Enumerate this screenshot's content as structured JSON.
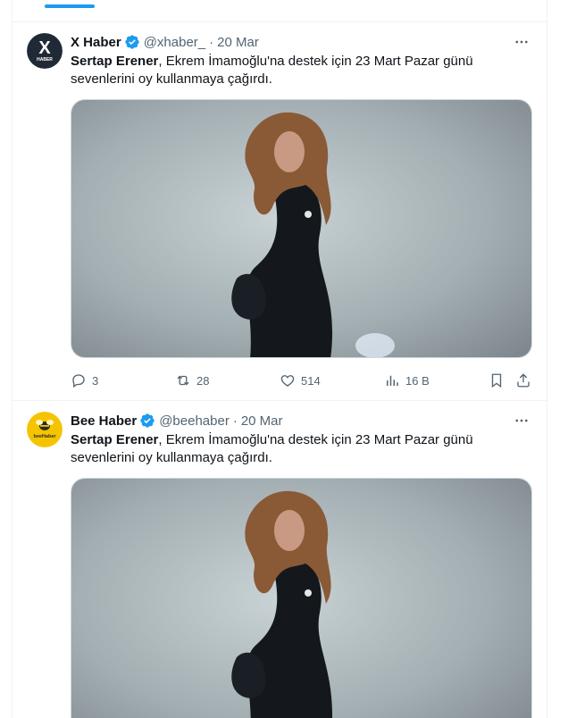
{
  "tweets": [
    {
      "author": "X Haber",
      "handle": "@xhaber_",
      "date": "20 Mar",
      "avatar_text": "X",
      "avatar_sub": "HABER",
      "text_bold": "Sertap Erener",
      "text_rest": ", Ekrem İmamoğlu'na destek için 23 Mart Pazar günü sevenlerini oy kullanmaya çağırdı.",
      "replies": "3",
      "retweets": "28",
      "likes": "514",
      "views": "16 B"
    },
    {
      "author": "Bee Haber",
      "handle": "@beehaber",
      "date": "20 Mar",
      "avatar_text": "beeHaber",
      "text_bold": "Sertap Erener",
      "text_rest": ", Ekrem İmamoğlu'na destek için 23 Mart Pazar günü sevenlerini oy kullanmaya çağırdı."
    }
  ],
  "colors": {
    "accent": "#1d9bf0",
    "muted": "#536471",
    "text": "#0f1419"
  },
  "icons": [
    "verified-badge-icon",
    "more-icon",
    "reply-icon",
    "retweet-icon",
    "like-icon",
    "views-icon",
    "bookmark-icon",
    "share-icon"
  ]
}
